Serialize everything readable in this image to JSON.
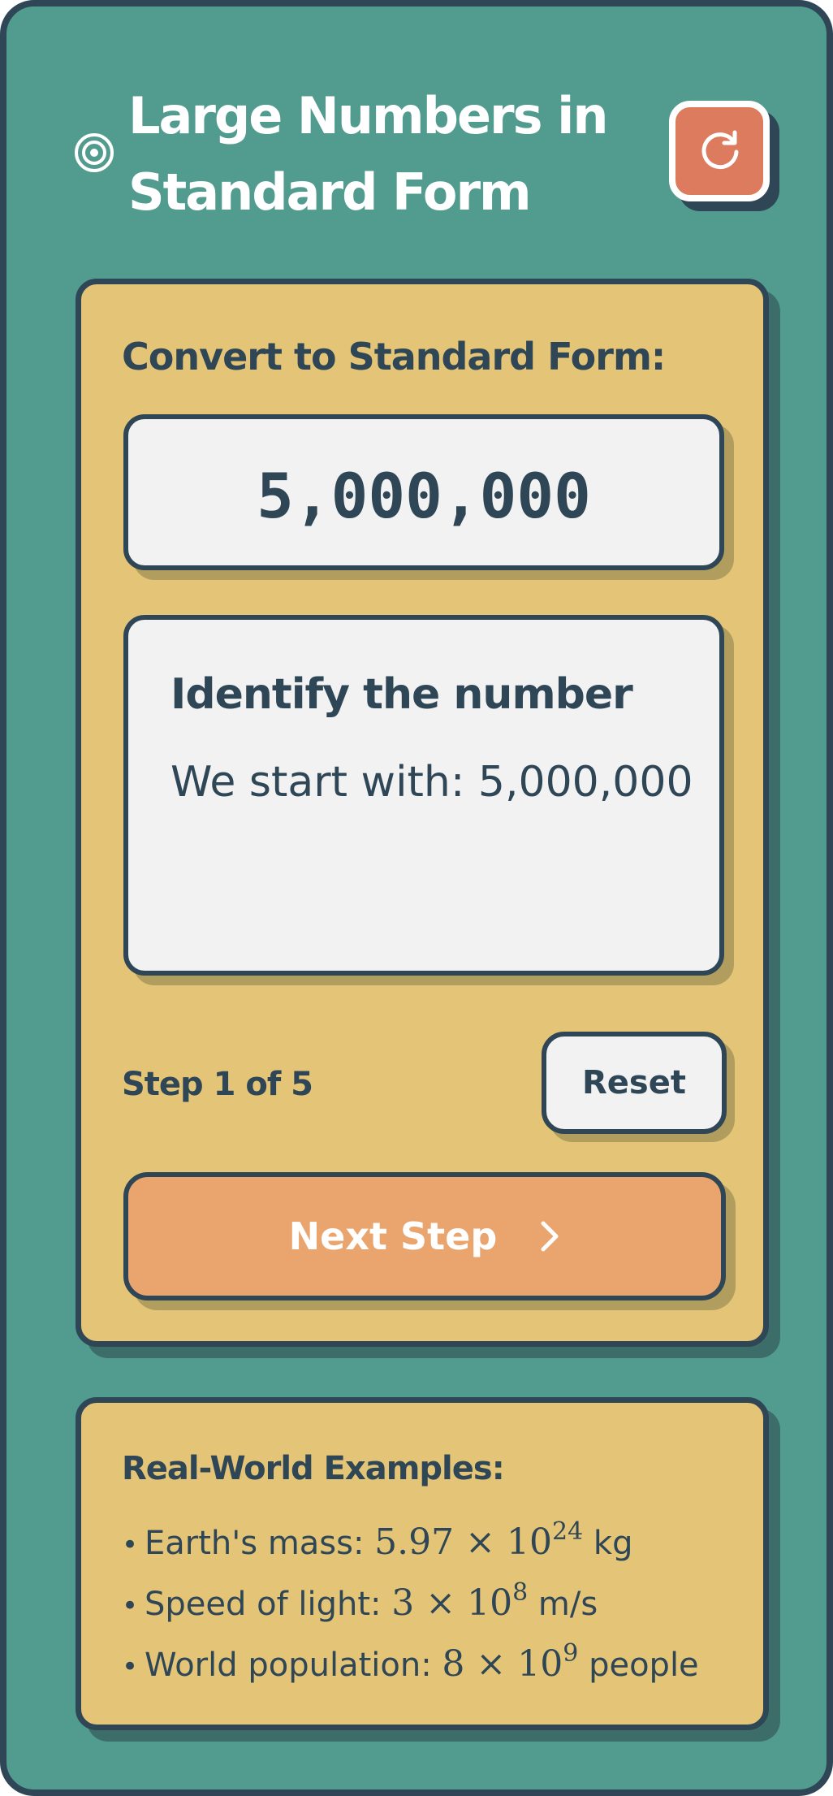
{
  "header": {
    "title": "Large Numbers in Standard Form",
    "target_icon": "target-icon",
    "refresh_icon": "refresh-icon"
  },
  "converter": {
    "prompt": "Convert to Standard Form:",
    "number": "5,000,000",
    "step": {
      "title": "Identify the number",
      "description": "We start with: 5,000,000"
    },
    "step_counter": "Step 1 of 5",
    "progress": {
      "current": 1,
      "total": 5
    },
    "reset_label": "Reset",
    "next_label": "Next Step",
    "next_icon": "chevron-right-icon"
  },
  "examples": {
    "title": "Real-World Examples:",
    "items": [
      {
        "label": "Earth's mass:",
        "mantissa": "5.97",
        "times": "×",
        "base": "10",
        "exponent": "24",
        "unit": "kg"
      },
      {
        "label": "Speed of light:",
        "mantissa": "3",
        "times": "×",
        "base": "10",
        "exponent": "8",
        "unit": "m/s"
      },
      {
        "label": "World population:",
        "mantissa": "8",
        "times": "×",
        "base": "10",
        "exponent": "9",
        "unit": "people"
      }
    ]
  },
  "colors": {
    "background": "#529c8f",
    "border": "#2e4655",
    "card": "#e4c476",
    "panel": "#f2f2f2",
    "refresh_button": "#dc7b5d",
    "next_button": "#eaa56e",
    "text": "#2e4655"
  }
}
